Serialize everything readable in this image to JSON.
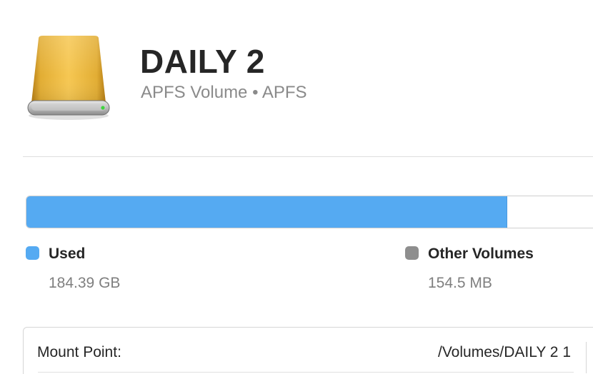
{
  "volume": {
    "name": "DAILY 2",
    "subtitle": "APFS Volume • APFS",
    "icon": "external-drive-icon",
    "icon_color": "#E8B53A"
  },
  "usage": {
    "used_fraction": 0.842,
    "used_color": "#55AAF2",
    "other_color": "#8E8E8E",
    "legend": [
      {
        "label": "Used",
        "value": "184.39 GB"
      },
      {
        "label": "Other Volumes",
        "value": "154.5 MB"
      }
    ]
  },
  "info": {
    "rows": [
      {
        "label": "Mount Point:",
        "value": "/Volumes/DAILY 2 1"
      }
    ]
  }
}
